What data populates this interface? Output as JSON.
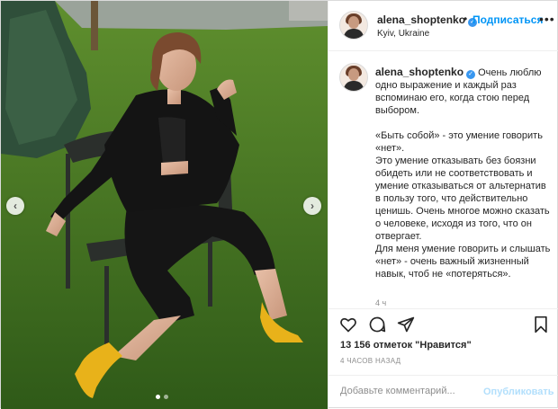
{
  "post": {
    "username": "alena_shoptenko",
    "verified": true,
    "follow_label": "Подписаться",
    "separator": "•",
    "location": "Kyiv, Ukraine",
    "more_icon": "ellipsis-icon",
    "caption_lines": [
      "Очень люблю одно выражение и каждый раз вспоминаю его, когда стою перед выбором.",
      "",
      "«Быть собой» - это умение говорить «нет».",
      "Это умение отказывать без боязни обидеть или не соответствовать и умение отказываться от альтернатив в пользу того, что действительно ценишь. Очень многое можно сказать о человеке, исходя из того, что он отвергает.",
      "Для меня умение говорить и слышать «нет» - очень важный жизненный навык, чтоб не «потеряться»."
    ],
    "caption_time": "4 ч",
    "likes": "13 156 отметок \"Нравится\"",
    "time_ago": "4 ЧАСОВ НАЗАД",
    "comment_placeholder": "Добавьте комментарий...",
    "publish_label": "Опубликовать",
    "carousel": {
      "slides": 2,
      "active_slide": 1
    }
  },
  "icons": {
    "prev": "chevron-left-icon",
    "next": "chevron-right-icon",
    "like": "heart-icon",
    "comment": "comment-icon",
    "share": "paper-plane-icon",
    "save": "bookmark-icon"
  },
  "colors": {
    "accent": "#0095f6",
    "publish_disabled": "#b2dffc",
    "muted": "#8e8e8e",
    "verified": "#3897f0"
  }
}
